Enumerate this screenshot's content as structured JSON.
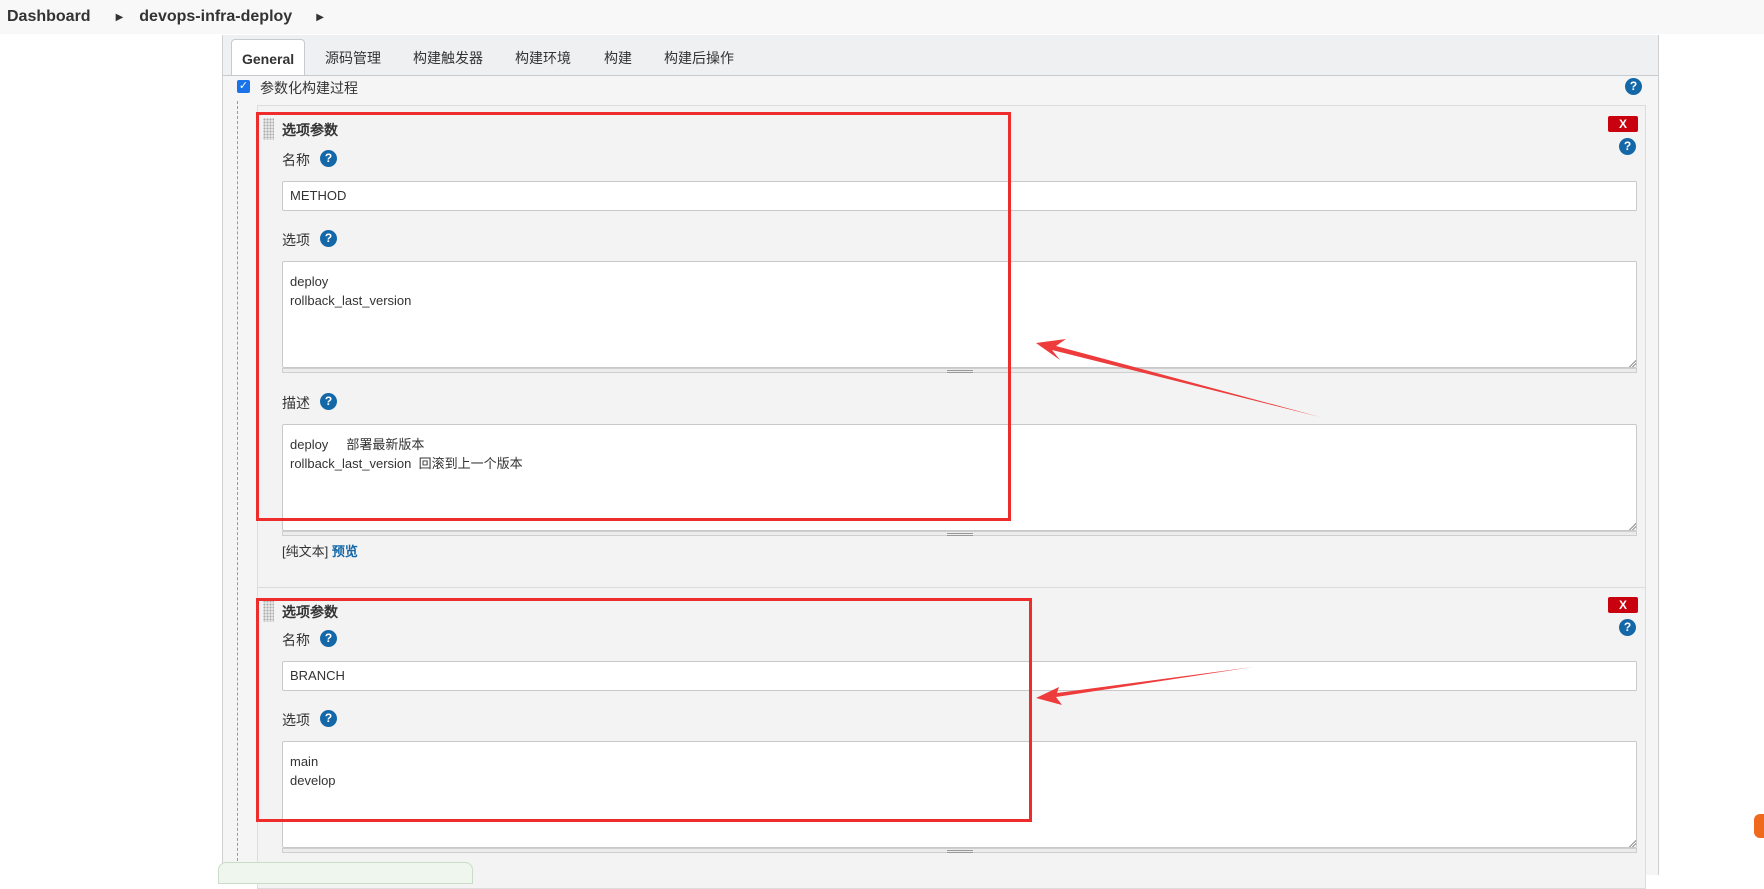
{
  "breadcrumb": {
    "items": [
      "Dashboard",
      "devops-infra-deploy"
    ]
  },
  "tabs": [
    "General",
    "源码管理",
    "构建触发器",
    "构建环境",
    "构建",
    "构建后操作"
  ],
  "param_section": {
    "label": "参数化构建过程",
    "checked": true
  },
  "delete_label": "X",
  "help_glyph": "?",
  "check_glyph": "✓",
  "params": [
    {
      "type_label": "选项参数",
      "name_label": "名称",
      "name_value": "METHOD",
      "choices_label": "选项",
      "choices_value": "deploy\nrollback_last_version",
      "desc_label": "描述",
      "desc_value": "deploy     部署最新版本\nrollback_last_version  回滚到上一个版本",
      "preview_plain": "[纯文本]",
      "preview_link": "预览"
    },
    {
      "type_label": "选项参数",
      "name_label": "名称",
      "name_value": "BRANCH",
      "choices_label": "选项",
      "choices_value": "main\ndevelop"
    }
  ],
  "colors": {
    "highlight": "#ee2c2c",
    "delete": "#c9000d",
    "help": "#1468a8",
    "checkbox": "#1a73e8"
  },
  "icons": [
    "chevron-right-icon",
    "help-icon",
    "delete-icon",
    "drag-handle-icon",
    "resize-handle-icon",
    "annotation-arrow-icon"
  ]
}
